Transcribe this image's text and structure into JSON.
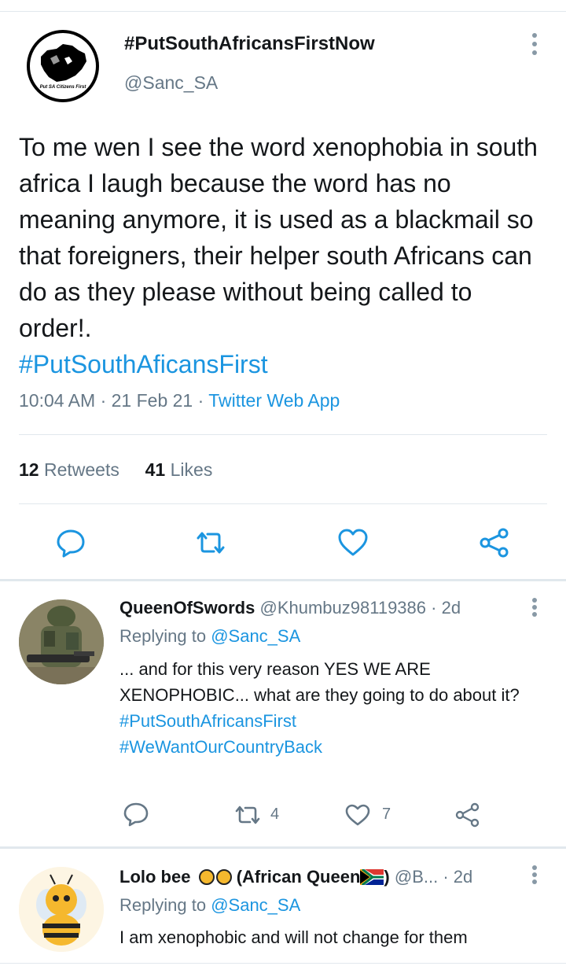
{
  "main_tweet": {
    "display_name": "#PutSouthAfricansFirstNow",
    "handle": "@Sanc_SA",
    "avatar_caption": "Put SA Citizens First",
    "text": "To me wen I see the word xenophobia in south africa I laugh because the word has no meaning anymore, it is used as a blackmail so that foreigners, their helper south Africans can do as they please without being called to order!.",
    "hashtag": "#PutSouthAficansFirst",
    "time": "10:04 AM",
    "date": "21 Feb 21",
    "app": "Twitter Web App",
    "retweets_count": "12",
    "retweets_label": "Retweets",
    "likes_count": "41",
    "likes_label": "Likes"
  },
  "replies": [
    {
      "name": "QueenOfSwords",
      "handle": "@Khumbuz98119386",
      "age": "2d",
      "replying_label": "Replying to",
      "replying_to": "@Sanc_SA",
      "text": "... and for this very reason YES WE ARE XENOPHOBIC... what are they going to do about it?",
      "hashtags": [
        "#PutSouthAfricansFirst",
        "#WeWantOurCountryBack"
      ],
      "retweets": "4",
      "likes": "7"
    },
    {
      "name": "Lolo bee",
      "name_suffix": "(African Queen",
      "name_close": ")",
      "handle": "@B...",
      "age": "2d",
      "replying_label": "Replying to",
      "replying_to": "@Sanc_SA",
      "text": "I am xenophobic and will not change for them"
    }
  ],
  "separator": "·",
  "icons": [
    "more-icon",
    "reply-icon",
    "retweet-icon",
    "like-icon",
    "share-icon",
    "bee-emoji-icon",
    "south-africa-flag-icon"
  ],
  "colors": {
    "link": "#1b95e0",
    "secondary": "#657786",
    "icon": "#1b95e0",
    "divider": "#e1e8ed"
  }
}
